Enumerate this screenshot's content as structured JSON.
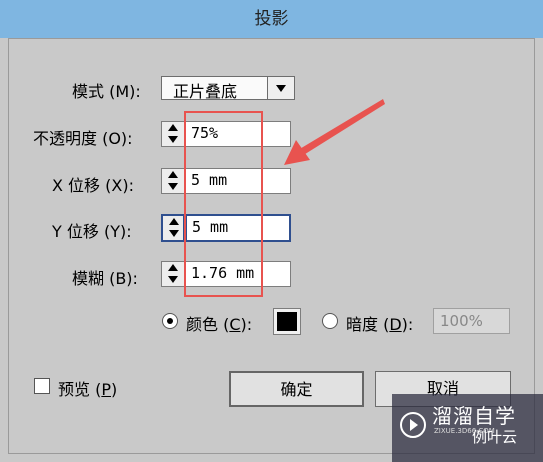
{
  "window": {
    "title": "投影"
  },
  "mode": {
    "label": "模式 (M):",
    "value": "正片叠底"
  },
  "opacity": {
    "label": "不透明度 (O):",
    "value": "75%"
  },
  "x_offset": {
    "label": "X 位移 (X):",
    "value": "5 mm"
  },
  "y_offset": {
    "label": "Y 位移 (Y):",
    "value": "5 mm"
  },
  "blur": {
    "label": "模糊 (B):",
    "value": "1.76 mm"
  },
  "color_option": {
    "label_pre": "颜色 (",
    "key": "C",
    "label_post": "):",
    "selected": true,
    "swatch_color": "#000000"
  },
  "darkness_option": {
    "label_pre": "暗度 (",
    "key": "D",
    "label_post": "):",
    "selected": false,
    "value": "100%"
  },
  "preview": {
    "label_pre": "预览 (",
    "key": "P",
    "label_post": ")",
    "checked": false
  },
  "buttons": {
    "ok": "确定",
    "cancel": "取消"
  },
  "watermark": {
    "text": "溜溜自学",
    "sub": "ZIXUE.3D66.COM",
    "cloud": "例叶云"
  },
  "colors": {
    "title_bar": "#7fb6e1",
    "dialog_bg": "#c9c9c9",
    "annotation": "#e8534f",
    "focus_border": "#2f4f8f"
  }
}
